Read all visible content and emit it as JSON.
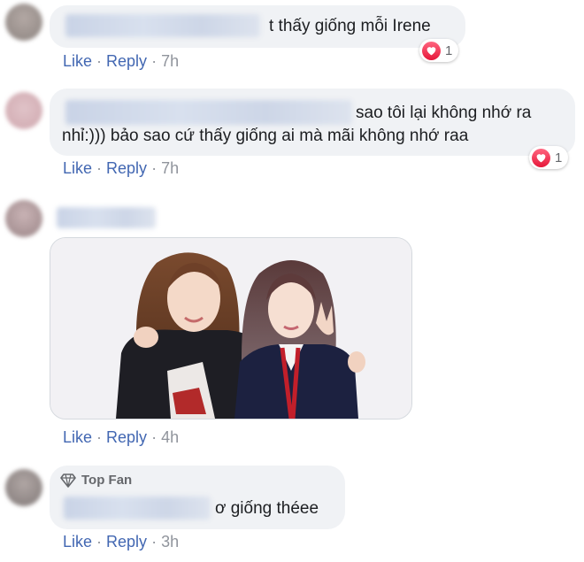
{
  "actions": {
    "like": "Like",
    "reply": "Reply",
    "separator": "·"
  },
  "comments": [
    {
      "text": "t thấy giống mỗi Irene",
      "time": "7h",
      "reaction_count": "1"
    },
    {
      "line1": "sao tôi lại không nhớ ra",
      "line2": "nhỉ:))) bảo sao cứ thấy giống ai mà mãi không nhớ raa",
      "time": "7h",
      "reaction_count": "1"
    },
    {
      "time": "4h"
    },
    {
      "badge": "Top Fan",
      "text": "ơ giống théee",
      "time": "3h"
    }
  ],
  "colors": {
    "link": "#4267b2",
    "meta": "#90949c",
    "bubble": "#f0f2f5",
    "heart": "#f33e58"
  },
  "icons": {
    "reaction": "heart-icon",
    "badge": "diamond-icon"
  }
}
